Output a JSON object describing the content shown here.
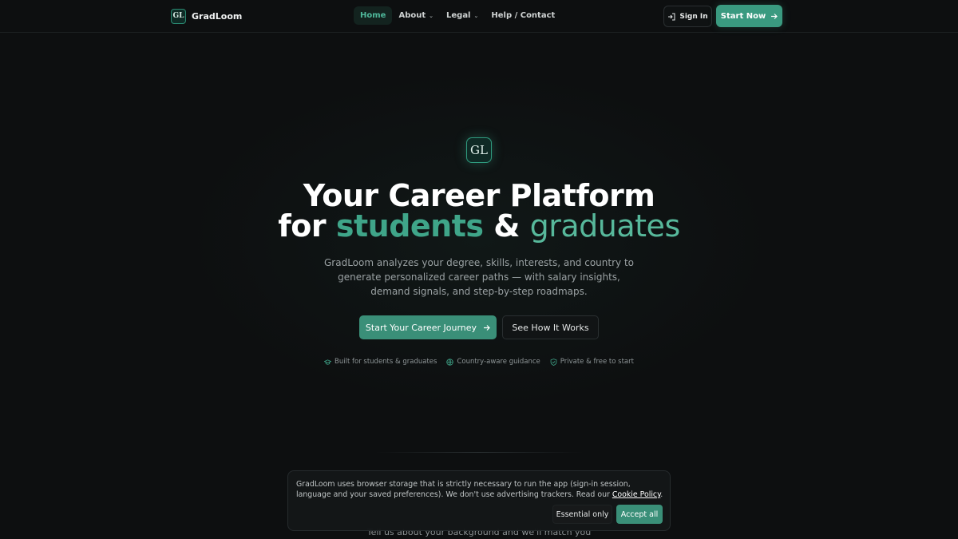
{
  "nav": {
    "brand_logo": "GL",
    "brand_name": "GradLoom",
    "links": [
      {
        "label": "Home",
        "active": true
      },
      {
        "label": "About",
        "chevron": "chevron-down-icon"
      },
      {
        "label": "Legal",
        "chevron": "chevron-down-icon"
      },
      {
        "label": "Help / Contact"
      }
    ],
    "sign_in": "Sign In",
    "start_now": "Start Now"
  },
  "hero": {
    "logo": "GL",
    "title_line1": "Your Career Platform",
    "title_for": "for",
    "title_students": "students",
    "title_amp": "&",
    "title_graduates": "graduates",
    "subtitle": "GradLoom analyzes your degree, skills, interests, and country to generate personalized career paths — with salary insights, demand signals, and step-by-step roadmaps.",
    "cta_primary": "Start Your Career Journey",
    "cta_secondary": "See How It Works",
    "badges": [
      {
        "icon": "graduation-cap-icon",
        "label": "Built for students & graduates"
      },
      {
        "icon": "globe-icon",
        "label": "Country-aware guidance"
      },
      {
        "icon": "shield-icon",
        "label": "Private & free to start"
      }
    ]
  },
  "section_below": {
    "text": "Tell us about your background and we'll match you"
  },
  "cookie": {
    "text_before": "GradLoom uses browser storage that is strictly necessary to run the app (sign-in session, language and your saved preferences). We don't use advertising trackers. Read our ",
    "link": "Cookie Policy",
    "text_after": ".",
    "essential_only": "Essential only",
    "accept_all": "Accept all"
  },
  "colors": {
    "accent": "#3a9a80",
    "background": "#0d0f10"
  }
}
